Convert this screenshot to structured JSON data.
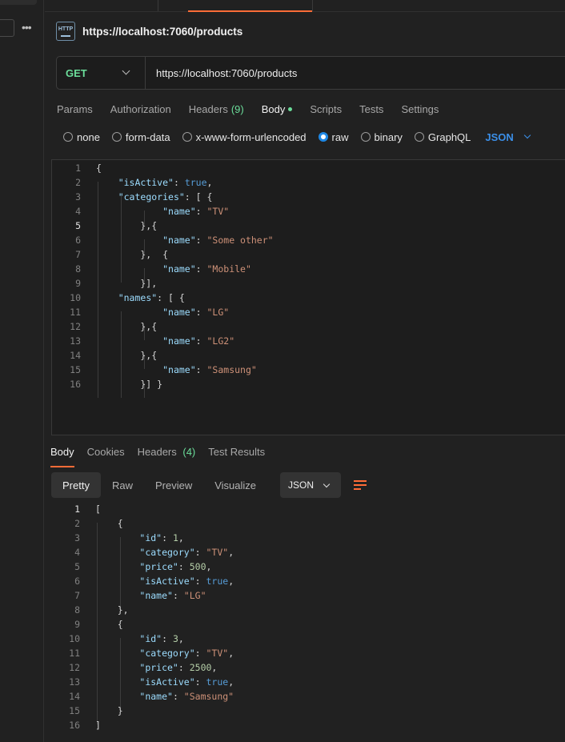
{
  "request": {
    "title": "https://localhost:7060/products",
    "method": "GET",
    "url": "https://localhost:7060/products"
  },
  "request_tabs": [
    {
      "label": "Params"
    },
    {
      "label": "Authorization"
    },
    {
      "label": "Headers",
      "count": "(9)"
    },
    {
      "label": "Body"
    },
    {
      "label": "Scripts"
    },
    {
      "label": "Tests"
    },
    {
      "label": "Settings"
    }
  ],
  "body_types": [
    {
      "label": "none"
    },
    {
      "label": "form-data"
    },
    {
      "label": "x-www-form-urlencoded"
    },
    {
      "label": "raw"
    },
    {
      "label": "binary"
    },
    {
      "label": "GraphQL"
    }
  ],
  "body_format": "JSON",
  "request_body_lines": [
    "{",
    "    \"isActive\": true,",
    "    \"categories\": [ {",
    "            \"name\": \"TV\"",
    "        },{",
    "            \"name\": \"Some other\"",
    "        },  {",
    "            \"name\": \"Mobile\"",
    "        }],",
    "    \"names\": [ {",
    "            \"name\": \"LG\"",
    "        },{",
    "            \"name\": \"LG2\"",
    "        },{",
    "            \"name\": \"Samsung\"",
    "        }] }"
  ],
  "response_tabs": [
    {
      "label": "Body"
    },
    {
      "label": "Cookies"
    },
    {
      "label": "Headers",
      "count": "(4)"
    },
    {
      "label": "Test Results"
    }
  ],
  "view_modes": [
    {
      "label": "Pretty"
    },
    {
      "label": "Raw"
    },
    {
      "label": "Preview"
    },
    {
      "label": "Visualize"
    }
  ],
  "response_format": "JSON",
  "response_body_lines": [
    "[",
    "    {",
    "        \"id\": 1,",
    "        \"category\": \"TV\",",
    "        \"price\": 500,",
    "        \"isActive\": true,",
    "        \"name\": \"LG\"",
    "    },",
    "    {",
    "        \"id\": 3,",
    "        \"category\": \"TV\",",
    "        \"price\": 2500,",
    "        \"isActive\": true,",
    "        \"name\": \"Samsung\"",
    "    }",
    "]"
  ],
  "icons": {
    "request_type": "http-icon",
    "more": "more-dots-icon",
    "method_dropdown": "chevron-down-icon",
    "wrap": "wrap-lines-icon"
  },
  "colors": {
    "accent": "#ff6c37",
    "method_get": "#6bdd9a",
    "json_blue": "#3b8fe8",
    "radio_selected": "#1e88e5"
  }
}
